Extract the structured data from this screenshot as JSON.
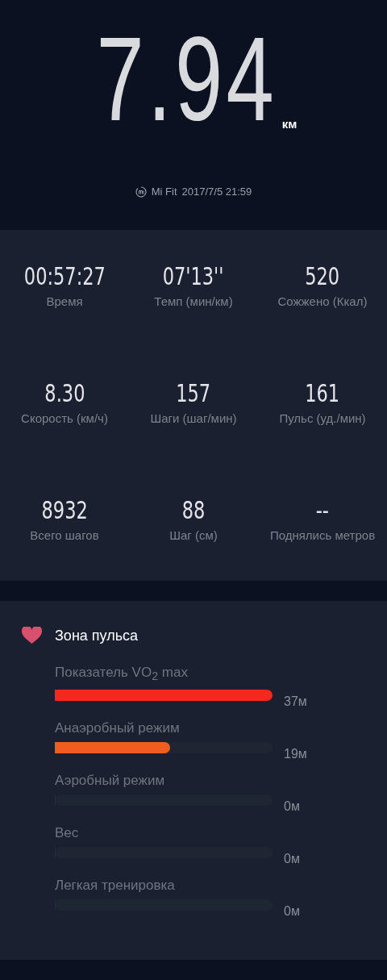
{
  "distance": {
    "value": "7.94",
    "unit": "км"
  },
  "source": {
    "app": "Mi Fit",
    "datetime": "2017/7/5 21:59"
  },
  "stats": [
    {
      "value": "00:57:27",
      "label": "Время"
    },
    {
      "value": "07'13''",
      "label": "Темп (мин/км)"
    },
    {
      "value": "520",
      "label": "Сожжено (Ккал)"
    },
    {
      "value": "8.30",
      "label": "Скорость (км/ч)"
    },
    {
      "value": "157",
      "label": "Шаги (шаг/мин)"
    },
    {
      "value": "161",
      "label": "Пульс (уд./мин)"
    },
    {
      "value": "8932",
      "label": "Всего шагов"
    },
    {
      "value": "88",
      "label": "Шаг (см)"
    },
    {
      "value": "--",
      "label": "Поднялись метров"
    }
  ],
  "heart_zones": {
    "title": "Зона пульса",
    "zones": [
      {
        "label": "Показатель VO$_{2}$ max",
        "level": 1,
        "color": "#f5281e",
        "duration": "37м"
      },
      {
        "label": "Анаэробный режим",
        "level": 0.53,
        "color": "#ef5d1f",
        "duration": "19м"
      },
      {
        "label": "Аэробный режим",
        "level": 0,
        "duration": "0м"
      },
      {
        "label": "Вес",
        "level": 0,
        "duration": "0м"
      },
      {
        "label": "Легкая тренировка",
        "level": 0,
        "duration": "0м"
      }
    ]
  }
}
